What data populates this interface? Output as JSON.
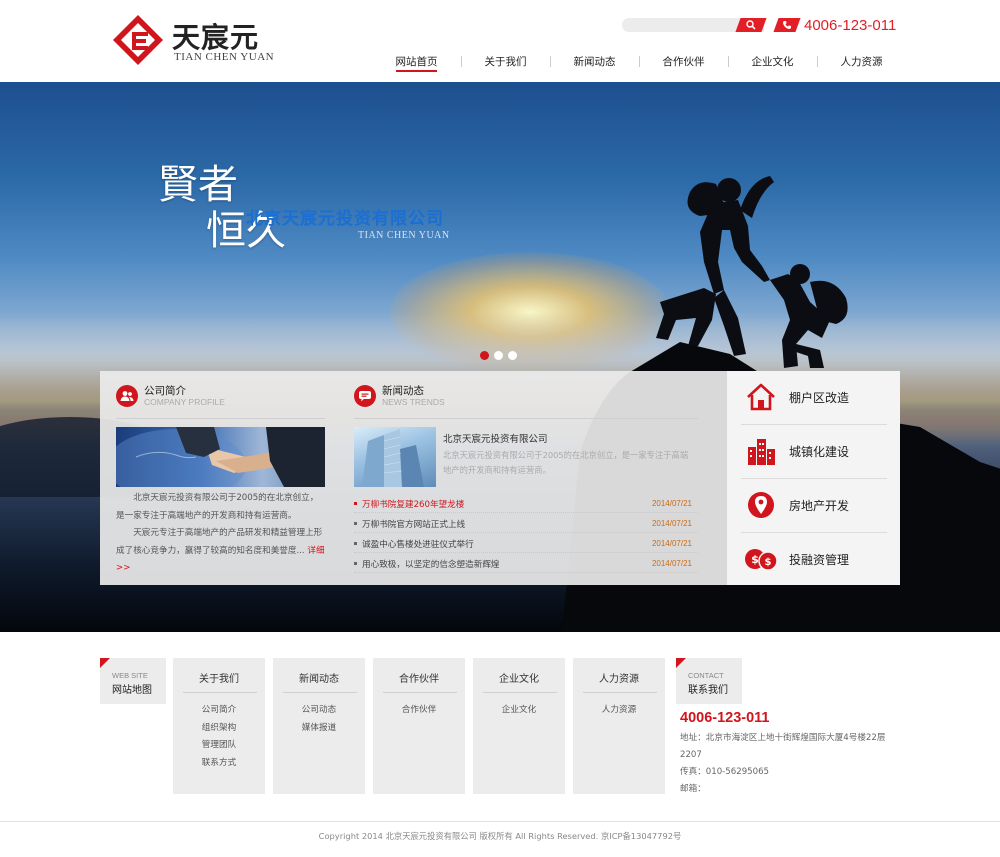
{
  "brand": {
    "name_cn": "天宸元",
    "name_en": "TIAN CHEN YUAN",
    "accent_color": "#d0151c"
  },
  "header": {
    "phone": "4006-123-011",
    "search_icon": "search-icon",
    "phone_icon": "phone-icon"
  },
  "nav": {
    "items": [
      "网站首页",
      "关于我们",
      "新闻动态",
      "合作伙伴",
      "企业文化",
      "人力资源"
    ],
    "active_index": 0
  },
  "banner": {
    "calligraphy_line1": "賢者",
    "calligraphy_line2": "恒久",
    "company": "北京天宸元投资有限公司",
    "company_en": "TIAN CHEN YUAN",
    "slides": 3,
    "active_slide": 0
  },
  "about": {
    "title": "公司简介",
    "title_en": "COMPANY PROFILE",
    "para1": "北京天宸元投资有限公司于2005的在北京创立，是一家专注于高端地产的开发商和持有运营商。",
    "para2": "天宸元专注于高端地产的产品研发和精益管理上形成了核心竞争力，赢得了较高的知名度和美誉度...",
    "more": "详细>>"
  },
  "news": {
    "title": "新闻动态",
    "title_en": "NEWS TRENDS",
    "featured_title": "北京天宸元投资有限公司",
    "featured_desc": "北京天宸元投资有限公司于2005的在北京创立，是一家专注于高端地产的开发商和持有运营商。",
    "items": [
      {
        "text": "万柳书院复建260年望龙楼",
        "date": "2014/07/21",
        "hot": true
      },
      {
        "text": "万柳书院官方网站正式上线",
        "date": "2014/07/21",
        "hot": false
      },
      {
        "text": "诚盈中心售楼处进驻仪式举行",
        "date": "2014/07/21",
        "hot": false
      },
      {
        "text": "用心致极，以坚定的信念塑造新辉煌",
        "date": "2014/07/21",
        "hot": false
      }
    ]
  },
  "services": [
    {
      "label": "棚户区改造",
      "icon": "house-icon"
    },
    {
      "label": "城镇化建设",
      "icon": "buildings-icon"
    },
    {
      "label": "房地产开发",
      "icon": "location-pin-icon"
    },
    {
      "label": "投融资管理",
      "icon": "coins-icon"
    }
  ],
  "footer": {
    "sitemap_en": "WEB SITE",
    "sitemap_cn": "网站地图",
    "columns": [
      {
        "title": "关于我们",
        "links": [
          "公司简介",
          "组织架构",
          "管理团队",
          "联系方式"
        ]
      },
      {
        "title": "新闻动态",
        "links": [
          "公司动态",
          "媒体报道"
        ]
      },
      {
        "title": "合作伙伴",
        "links": [
          "合作伙伴"
        ]
      },
      {
        "title": "企业文化",
        "links": [
          "企业文化"
        ]
      },
      {
        "title": "人力资源",
        "links": [
          "人力资源"
        ]
      }
    ],
    "contact_en": "CONTACT",
    "contact_cn": "联系我们",
    "contact_phone": "4006-123-011",
    "address": "地址：北京市海淀区上地十街辉煌国际大厦4号楼22层2207",
    "fax": "传真：010-56295065",
    "email": "邮箱：",
    "copyright": "Copyright 2014 北京天宸元投资有限公司 版权所有 All Rights Reserved.   京ICP备13047792号"
  }
}
